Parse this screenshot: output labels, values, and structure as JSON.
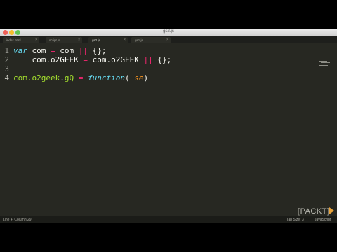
{
  "window": {
    "title": "gs2.js"
  },
  "tabs": [
    {
      "label": "index.html",
      "active": false
    },
    {
      "label": "script.js",
      "active": false
    },
    {
      "label": "gs2.js",
      "active": true
    },
    {
      "label": "gs1.js",
      "active": false
    }
  ],
  "editor": {
    "line_numbers": [
      "1",
      "2",
      "3",
      "4"
    ],
    "lines": [
      [
        {
          "t": "var",
          "c": "kw"
        },
        {
          "t": " com ",
          "c": "plain"
        },
        {
          "t": "=",
          "c": "op"
        },
        {
          "t": " com ",
          "c": "plain"
        },
        {
          "t": "||",
          "c": "op"
        },
        {
          "t": " {};",
          "c": "plain"
        }
      ],
      [
        {
          "t": "    com.o2GEEK ",
          "c": "plain"
        },
        {
          "t": "=",
          "c": "op"
        },
        {
          "t": " com.o2GEEK ",
          "c": "plain"
        },
        {
          "t": "||",
          "c": "op"
        },
        {
          "t": " {};",
          "c": "plain"
        }
      ],
      [],
      [
        {
          "t": "com.o2geek",
          "c": "fn"
        },
        {
          "t": ".",
          "c": "plain"
        },
        {
          "t": "gQ",
          "c": "fn"
        },
        {
          "t": " ",
          "c": "plain"
        },
        {
          "t": "=",
          "c": "op"
        },
        {
          "t": " ",
          "c": "plain"
        },
        {
          "t": "function",
          "c": "kw"
        },
        {
          "t": "( ",
          "c": "plain"
        },
        {
          "t": "se",
          "c": "arg"
        },
        {
          "t": "",
          "c": "cursor"
        },
        {
          "t": ")",
          "c": "plain"
        }
      ]
    ]
  },
  "statusbar": {
    "position": "Line 4, Column 29",
    "tab_size": "Tab Size: 3",
    "syntax": "JavaScript"
  },
  "watermark": {
    "text": "PACKT",
    "open_bracket": "[",
    "close_bracket": "]"
  },
  "colors": {
    "background": "#272822",
    "keyword": "#66d9ef",
    "operator": "#f92672",
    "function": "#a6e22e",
    "argument": "#fd971f"
  },
  "icons": [
    "close-icon",
    "minimize-icon",
    "maximize-icon",
    "play-icon"
  ]
}
